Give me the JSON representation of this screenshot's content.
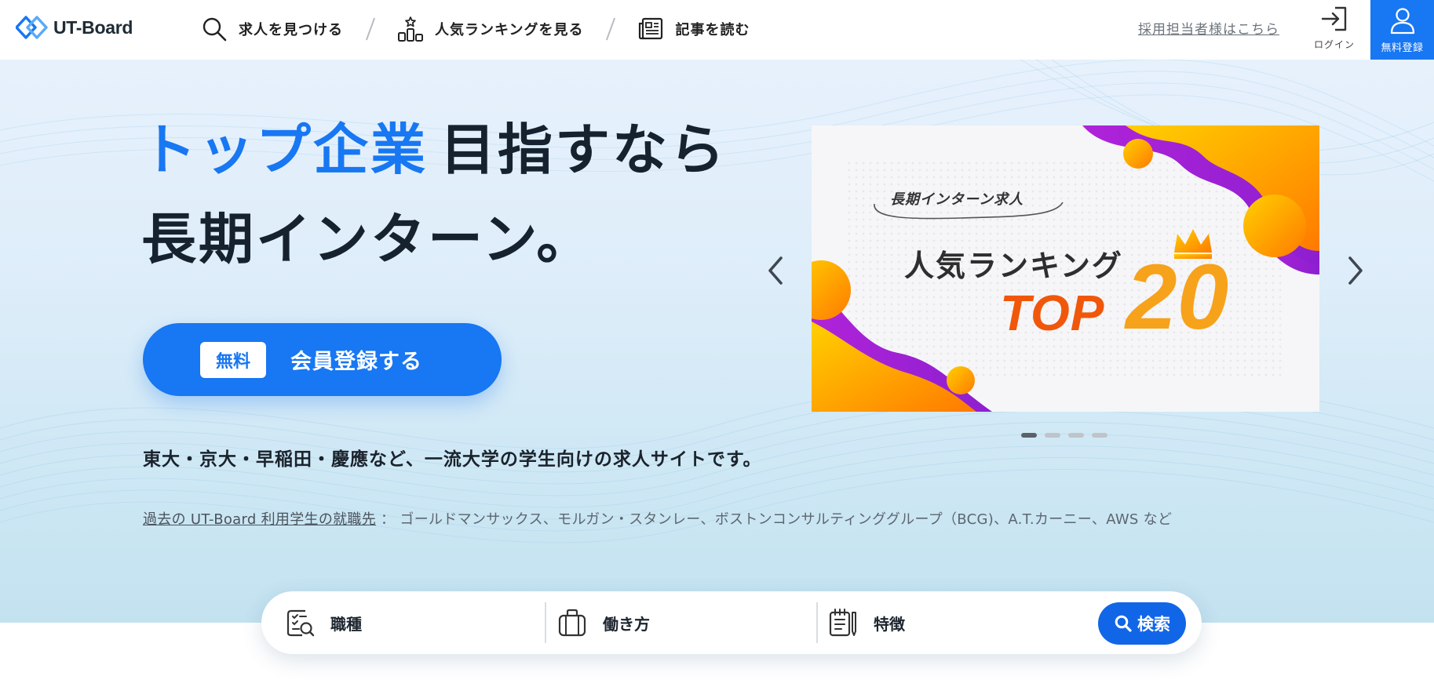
{
  "header": {
    "logo_text": "UT-Board",
    "nav": [
      {
        "label": "求人を見つける",
        "icon": "search-icon"
      },
      {
        "label": "人気ランキングを見る",
        "icon": "ranking-icon"
      },
      {
        "label": "記事を読む",
        "icon": "article-icon"
      }
    ],
    "recruiter_link": "採用担当者様はこちら",
    "login_label": "ログイン",
    "signup_label": "無料登録"
  },
  "hero": {
    "headline_blue": "トップ企業",
    "headline_dark": "目指すなら",
    "headline_line2": "長期インターン。",
    "cta_badge": "無料",
    "cta_label": "会員登録する",
    "tagline": "東大・京大・早稲田・慶應など、一流大学の学生向けの求人サイトです。",
    "past_link": "過去の UT-Board 利用学生の就職先",
    "past_sep": "：",
    "past_companies": "ゴールドマンサックス、モルガン・スタンレー、ボストンコンサルティンググループ（BCG)、A.T.カーニー、AWS など"
  },
  "banner": {
    "subtitle": "長期インターン求人",
    "title": "人気ランキング",
    "top_text": "TOP",
    "top_number": "20",
    "slide_count": 4,
    "active_slide": 1
  },
  "search": {
    "fields": [
      {
        "label": "職種",
        "icon": "job-type-icon"
      },
      {
        "label": "働き方",
        "icon": "briefcase-icon"
      },
      {
        "label": "特徴",
        "icon": "notebook-icon"
      }
    ],
    "button_label": "検索"
  },
  "colors": {
    "brand_blue": "#1877f2",
    "search_blue": "#1166e8",
    "banner_orange": "#f7a21b",
    "banner_purple": "#a52ad6"
  }
}
